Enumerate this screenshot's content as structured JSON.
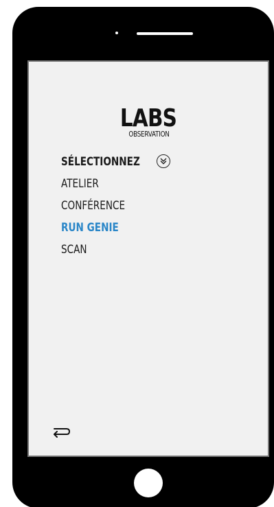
{
  "app": {
    "logo_main": "LABS",
    "logo_sub": "OBSERVATION"
  },
  "menu": {
    "header_label": "SÉLECTIONNEZ",
    "expand_icon": "double-chevron-down-icon",
    "items": [
      {
        "label": "ATELIER",
        "active": false
      },
      {
        "label": "CONFÉRENCE",
        "active": false
      },
      {
        "label": "RUN GENIE",
        "active": true
      },
      {
        "label": "SCAN",
        "active": false
      }
    ]
  },
  "navigation": {
    "back_icon": "return-arrow-icon"
  },
  "colors": {
    "accent": "#2a86c8",
    "text": "#1a1a1a",
    "screen_bg": "#f1f1f1",
    "device": "#000000"
  }
}
